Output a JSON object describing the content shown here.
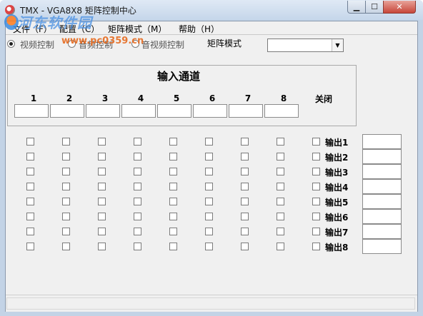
{
  "window": {
    "title": "TMX - VGA8X8 矩阵控制中心"
  },
  "titlebar_buttons": {
    "minimize": "▁",
    "maximize": "☐",
    "close": "✕"
  },
  "menu": [
    {
      "label": "文件（F）"
    },
    {
      "label": "配置（C）"
    },
    {
      "label": "矩阵模式（M）"
    },
    {
      "label": "帮助（H）"
    }
  ],
  "toolbar": {
    "radio_options": [
      {
        "label": "视频控制",
        "selected": true
      },
      {
        "label": "音频控制",
        "selected": false
      },
      {
        "label": "音视频控制",
        "selected": false
      }
    ],
    "mode_label": "矩阵模式",
    "mode_value": ""
  },
  "input_section": {
    "title": "输入通道",
    "channels": [
      "1",
      "2",
      "3",
      "4",
      "5",
      "6",
      "7",
      "8"
    ],
    "close_label": "关闭"
  },
  "outputs": [
    {
      "label": "输出1"
    },
    {
      "label": "输出2"
    },
    {
      "label": "输出3"
    },
    {
      "label": "输出4"
    },
    {
      "label": "输出5"
    },
    {
      "label": "输出6"
    },
    {
      "label": "输出7"
    },
    {
      "label": "输出8"
    }
  ],
  "watermark": {
    "name": "河东软件园",
    "url": "www.pc0359.cn"
  }
}
